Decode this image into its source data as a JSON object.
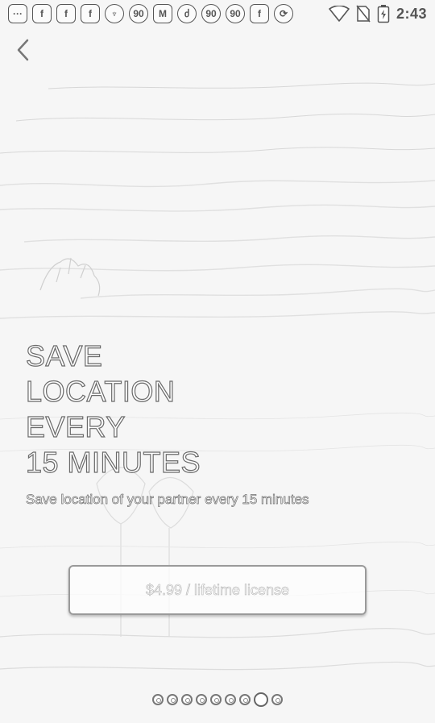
{
  "status_bar": {
    "notifications": [
      {
        "icon": "chat-bubble-icon",
        "glyph": "···"
      },
      {
        "icon": "facebook-icon",
        "glyph": "f"
      },
      {
        "icon": "facebook-icon",
        "glyph": "f"
      },
      {
        "icon": "facebook-icon",
        "glyph": "f"
      },
      {
        "icon": "location-pin-icon",
        "glyph": "♆"
      },
      {
        "icon": "app-90-icon",
        "glyph": "90"
      },
      {
        "icon": "gmail-icon",
        "glyph": "M"
      },
      {
        "icon": "flame-icon",
        "glyph": "ძ"
      },
      {
        "icon": "app-90-icon",
        "glyph": "90"
      },
      {
        "icon": "app-90-icon",
        "glyph": "90"
      },
      {
        "icon": "facebook-icon",
        "glyph": "f"
      },
      {
        "icon": "sync-icon",
        "glyph": "⟳"
      }
    ],
    "wifi_icon": "wifi-icon",
    "no_sim_icon": "no-sim-icon",
    "battery_icon": "battery-charging-icon",
    "time": "2:43"
  },
  "back_icon": "chevron-left-icon",
  "headline": {
    "line1": "SAVE",
    "line2": "LOCATION",
    "line3": "EVERY",
    "line4": "15 MINUTES"
  },
  "subtitle": "Save location of your partner every 15 minutes",
  "purchase_button": "$4.99 / lifetime license",
  "pager": {
    "total": 9,
    "active_index": 7
  }
}
